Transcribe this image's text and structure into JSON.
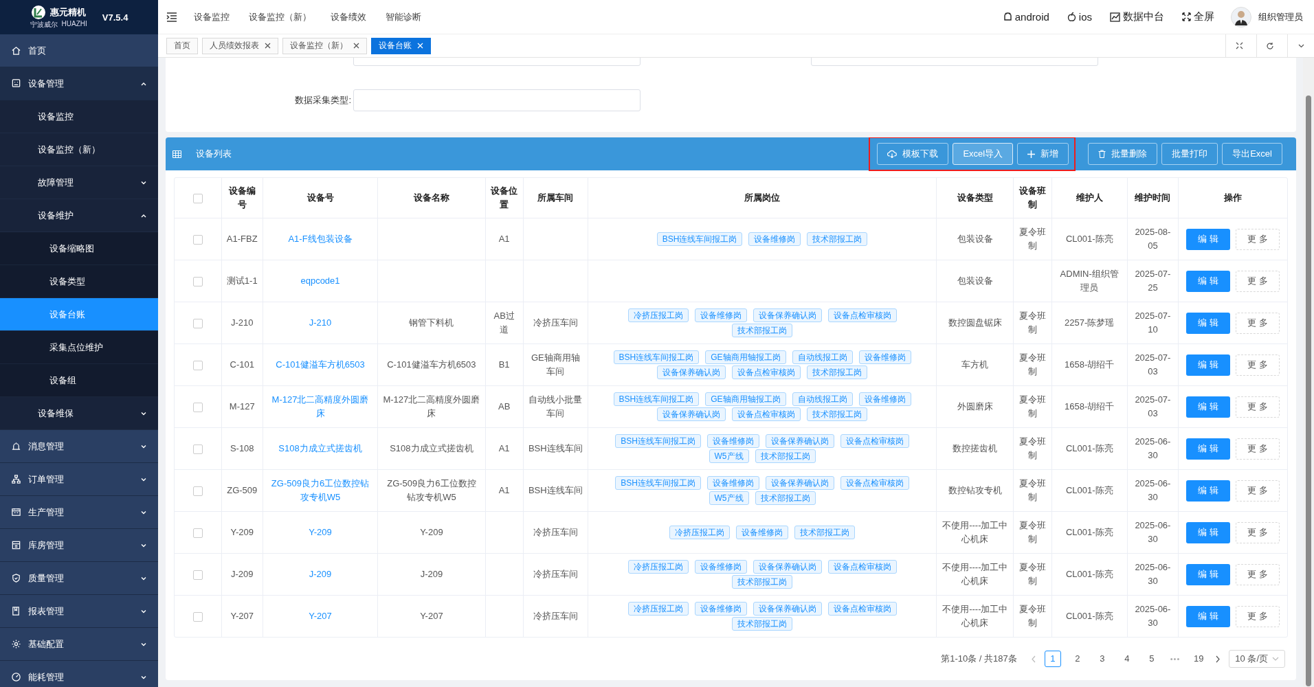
{
  "brand": {
    "name": "惠元精机",
    "sub": "宁波威尔",
    "sub2": "HUAZHI",
    "version": "V7.5.4"
  },
  "sidebar": {
    "items": [
      {
        "label": "首页",
        "selected": false
      },
      {
        "label": "设备管理",
        "selected": false,
        "expanded": true,
        "children": [
          {
            "label": "设备监控",
            "selected": false
          },
          {
            "label": "设备监控（新）",
            "selected": false
          },
          {
            "label": "故障管理",
            "selected": false,
            "expanded": false
          },
          {
            "label": "设备维护",
            "selected": false,
            "expanded": true,
            "children": [
              {
                "label": "设备缩略图",
                "selected": false
              },
              {
                "label": "设备类型",
                "selected": false
              },
              {
                "label": "设备台账",
                "selected": true
              },
              {
                "label": "采集点位维护",
                "selected": false
              },
              {
                "label": "设备组",
                "selected": false
              }
            ]
          },
          {
            "label": "设备维保",
            "selected": false,
            "expanded": false
          }
        ]
      },
      {
        "label": "消息管理",
        "selected": false,
        "expanded": false
      },
      {
        "label": "订单管理",
        "selected": false,
        "expanded": false
      },
      {
        "label": "生产管理",
        "selected": false,
        "expanded": false
      },
      {
        "label": "库房管理",
        "selected": false,
        "expanded": false
      },
      {
        "label": "质量管理",
        "selected": false,
        "expanded": false
      },
      {
        "label": "报表管理",
        "selected": false,
        "expanded": false
      },
      {
        "label": "基础配置",
        "selected": false,
        "expanded": false
      },
      {
        "label": "能耗管理",
        "selected": false,
        "expanded": false
      }
    ]
  },
  "top_nav": {
    "items": [
      "设备监控",
      "设备监控（新）",
      "设备绩效",
      "智能诊断"
    ]
  },
  "header_links": [
    {
      "kind": "android",
      "label": "android"
    },
    {
      "kind": "apple",
      "label": "ios"
    },
    {
      "kind": "chart",
      "label": "数据中台"
    },
    {
      "kind": "fullscreen",
      "label": "全屏"
    }
  ],
  "user": {
    "name": "组织管理员"
  },
  "tabs": [
    {
      "label": "首页",
      "closable": false,
      "selected": false
    },
    {
      "label": "人员绩效报表",
      "closable": true,
      "selected": false
    },
    {
      "label": "设备监控（新）",
      "closable": true,
      "selected": false
    },
    {
      "label": "设备台账",
      "closable": true,
      "selected": true
    }
  ],
  "filter_form": {
    "fields": [
      {
        "label": "数据采集类型:"
      }
    ]
  },
  "panel": {
    "title": "设备列表",
    "button_groups": [
      {
        "highlighted": true,
        "buttons": [
          {
            "kind": "download",
            "label": "模板下载"
          },
          {
            "kind": "import",
            "label": "Excel导入"
          },
          {
            "kind": "add",
            "label": "新增"
          }
        ]
      },
      {
        "buttons": [
          {
            "kind": "delete",
            "label": "批量删除"
          },
          {
            "kind": "print",
            "label": "批量打印"
          },
          {
            "kind": "export",
            "label": "导出Excel"
          }
        ]
      }
    ]
  },
  "table": {
    "header_checked": false,
    "columns": [
      "设备编号",
      "设备号",
      "设备名称",
      "设备位置",
      "所属车间",
      "所属岗位",
      "设备类型",
      "设备班制",
      "维护人",
      "维护时间",
      "操作"
    ],
    "rows": [
      {
        "checked": false,
        "code": "A1-FBZ",
        "number": "A1-F线包装设备",
        "location": "A1",
        "posts": [
          "BSH连线车间报工岗",
          "设备维修岗",
          "技术部报工岗"
        ],
        "type": "包装设备",
        "shift": "夏令班制",
        "maintainer": "CL001-陈亮",
        "time": "2025-08-05",
        "edit": "编 辑",
        "more": "更 多"
      },
      {
        "checked": false,
        "code": "测试1-1",
        "number": "eqpcode1",
        "type": "包装设备",
        "maintainer": "ADMIN-组织管理员",
        "time": "2025-07-25",
        "edit": "编 辑",
        "more": "更 多"
      },
      {
        "checked": false,
        "code": "J-210",
        "number": "J-210",
        "name": "钢管下料机",
        "location": "AB过道",
        "workshop": "冷挤压车间",
        "posts": [
          "冷挤压报工岗",
          "设备维修岗",
          "设备保养确认岗",
          "设备点检审核岗",
          "技术部报工岗"
        ],
        "type": "数控圆盘锯床",
        "shift": "夏令班制",
        "maintainer": "2257-陈梦瑶",
        "time": "2025-07-10",
        "edit": "编 辑",
        "more": "更 多"
      },
      {
        "checked": false,
        "code": "C-101",
        "number": "C-101健溢车方机6503",
        "name": "C-101健溢车方机6503",
        "location": "B1",
        "workshop": "GE轴商用轴车间",
        "posts": [
          "BSH连线车间报工岗",
          "GE轴商用轴报工岗",
          "自动线报工岗",
          "设备维修岗",
          "设备保养确认岗",
          "设备点检审核岗",
          "技术部报工岗"
        ],
        "type": "车方机",
        "shift": "夏令班制",
        "maintainer": "1658-胡绍千",
        "time": "2025-07-03",
        "edit": "编 辑",
        "more": "更 多"
      },
      {
        "checked": false,
        "code": "M-127",
        "number": "M-127北二高精度外圆磨床",
        "name": "M-127北二高精度外圆磨床",
        "location": "AB",
        "workshop": "自动线小批量车间",
        "posts": [
          "BSH连线车间报工岗",
          "GE轴商用轴报工岗",
          "自动线报工岗",
          "设备维修岗",
          "设备保养确认岗",
          "设备点检审核岗",
          "技术部报工岗"
        ],
        "type": "外圆磨床",
        "shift": "夏令班制",
        "maintainer": "1658-胡绍千",
        "time": "2025-07-03",
        "edit": "编 辑",
        "more": "更 多"
      },
      {
        "checked": false,
        "code": "S-108",
        "number": "S108力成立式搓齿机",
        "name": "S108力成立式搓齿机",
        "location": "A1",
        "workshop": "BSH连线车间",
        "posts": [
          "BSH连线车间报工岗",
          "设备维修岗",
          "设备保养确认岗",
          "设备点检审核岗",
          "W5产线",
          "技术部报工岗"
        ],
        "type": "数控搓齿机",
        "shift": "夏令班制",
        "maintainer": "CL001-陈亮",
        "time": "2025-06-30",
        "edit": "编 辑",
        "more": "更 多"
      },
      {
        "checked": false,
        "code": "ZG-509",
        "number": "ZG-509良力6工位数控钻攻专机W5",
        "name": "ZG-509良力6工位数控钻攻专机W5",
        "location": "A1",
        "workshop": "BSH连线车间",
        "posts": [
          "BSH连线车间报工岗",
          "设备维修岗",
          "设备保养确认岗",
          "设备点检审核岗",
          "W5产线",
          "技术部报工岗"
        ],
        "type": "数控钻攻专机",
        "shift": "夏令班制",
        "maintainer": "CL001-陈亮",
        "time": "2025-06-30",
        "edit": "编 辑",
        "more": "更 多"
      },
      {
        "checked": false,
        "code": "Y-209",
        "number": "Y-209",
        "name": "Y-209",
        "workshop": "冷挤压车间",
        "posts": [
          "冷挤压报工岗",
          "设备维修岗",
          "技术部报工岗"
        ],
        "type": "不使用----加工中心机床",
        "shift": "夏令班制",
        "maintainer": "CL001-陈亮",
        "time": "2025-06-30",
        "edit": "编 辑",
        "more": "更 多"
      },
      {
        "checked": false,
        "code": "J-209",
        "number": "J-209",
        "name": "J-209",
        "workshop": "冷挤压车间",
        "posts": [
          "冷挤压报工岗",
          "设备维修岗",
          "设备保养确认岗",
          "设备点检审核岗",
          "技术部报工岗"
        ],
        "type": "不使用----加工中心机床",
        "shift": "夏令班制",
        "maintainer": "CL001-陈亮",
        "time": "2025-06-30",
        "edit": "编 辑",
        "more": "更 多"
      },
      {
        "checked": false,
        "code": "Y-207",
        "number": "Y-207",
        "name": "Y-207",
        "workshop": "冷挤压车间",
        "posts": [
          "冷挤压报工岗",
          "设备维修岗",
          "设备保养确认岗",
          "设备点检审核岗",
          "技术部报工岗"
        ],
        "type": "不使用----加工中心机床",
        "shift": "夏令班制",
        "maintainer": "CL001-陈亮",
        "time": "2025-06-30",
        "edit": "编 辑",
        "more": "更 多"
      }
    ]
  },
  "pagination": {
    "summary": "第1-10条 / 共187条",
    "pages": [
      {
        "kind": "page",
        "label": "1",
        "selected": true
      },
      {
        "kind": "page",
        "label": "2",
        "selected": false
      },
      {
        "kind": "page",
        "label": "3",
        "selected": false
      },
      {
        "kind": "page",
        "label": "4",
        "selected": false
      },
      {
        "kind": "page",
        "label": "5",
        "selected": false
      },
      {
        "kind": "ellipsis",
        "label": "•••",
        "selected": false
      },
      {
        "kind": "page",
        "label": "19",
        "selected": false
      }
    ],
    "page_size": "10 条/页"
  }
}
